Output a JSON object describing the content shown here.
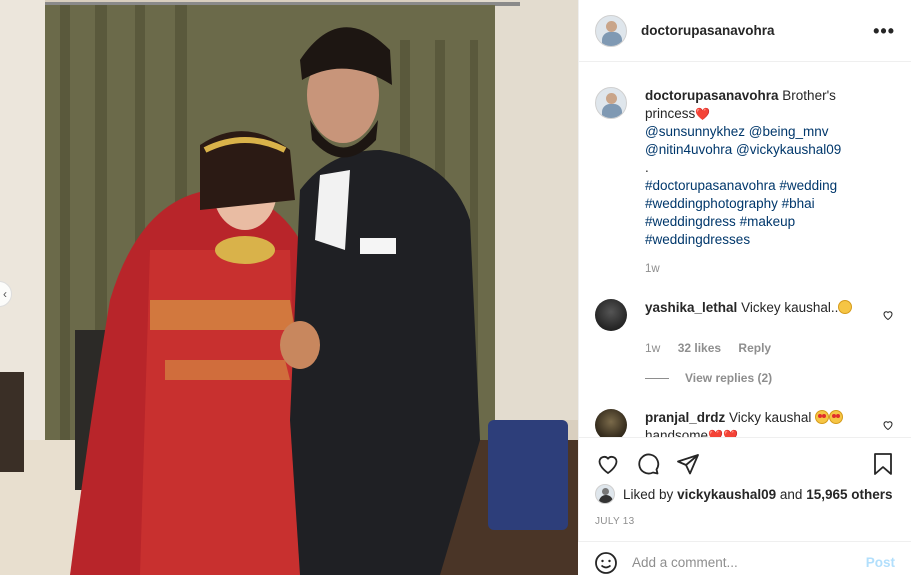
{
  "post": {
    "username": "doctorupasanavohra",
    "more_label": "•••"
  },
  "caption": {
    "username": "doctorupasanavohra",
    "text": "Brother's princess",
    "heart": "❤️",
    "tags": [
      "@sunsunnykhez",
      "@being_mnv",
      "@nitin4uvohra",
      "@vickykaushal09"
    ],
    "dot": ".",
    "hashtags": [
      "#doctorupasanavohra",
      "#wedding",
      "#weddingphotography",
      "#bhai",
      "#weddingdress",
      "#makeup",
      "#weddingdresses"
    ],
    "time_ago": "1w"
  },
  "comments": [
    {
      "username": "yashika_lethal",
      "text": "Vickey kaushal..",
      "time": "1w",
      "likes": "32 likes",
      "reply_label": "Reply",
      "view_replies": "View replies (2)"
    },
    {
      "username": "pranjal_drdz",
      "text": "Vicky kaushal",
      "text2": "handsome"
    }
  ],
  "actions": {
    "liked_by_prefix": "Liked by",
    "liked_by_user": "vickykaushal09",
    "liked_by_and": "and",
    "liked_by_count": "15,965 others",
    "date": "JULY 13"
  },
  "add_comment": {
    "placeholder": "Add a comment...",
    "post_label": "Post"
  },
  "colors": {
    "link": "#00376b",
    "muted": "#8e8e8e",
    "post_disabled": "#b2dffc",
    "heart": "#e0245e"
  }
}
